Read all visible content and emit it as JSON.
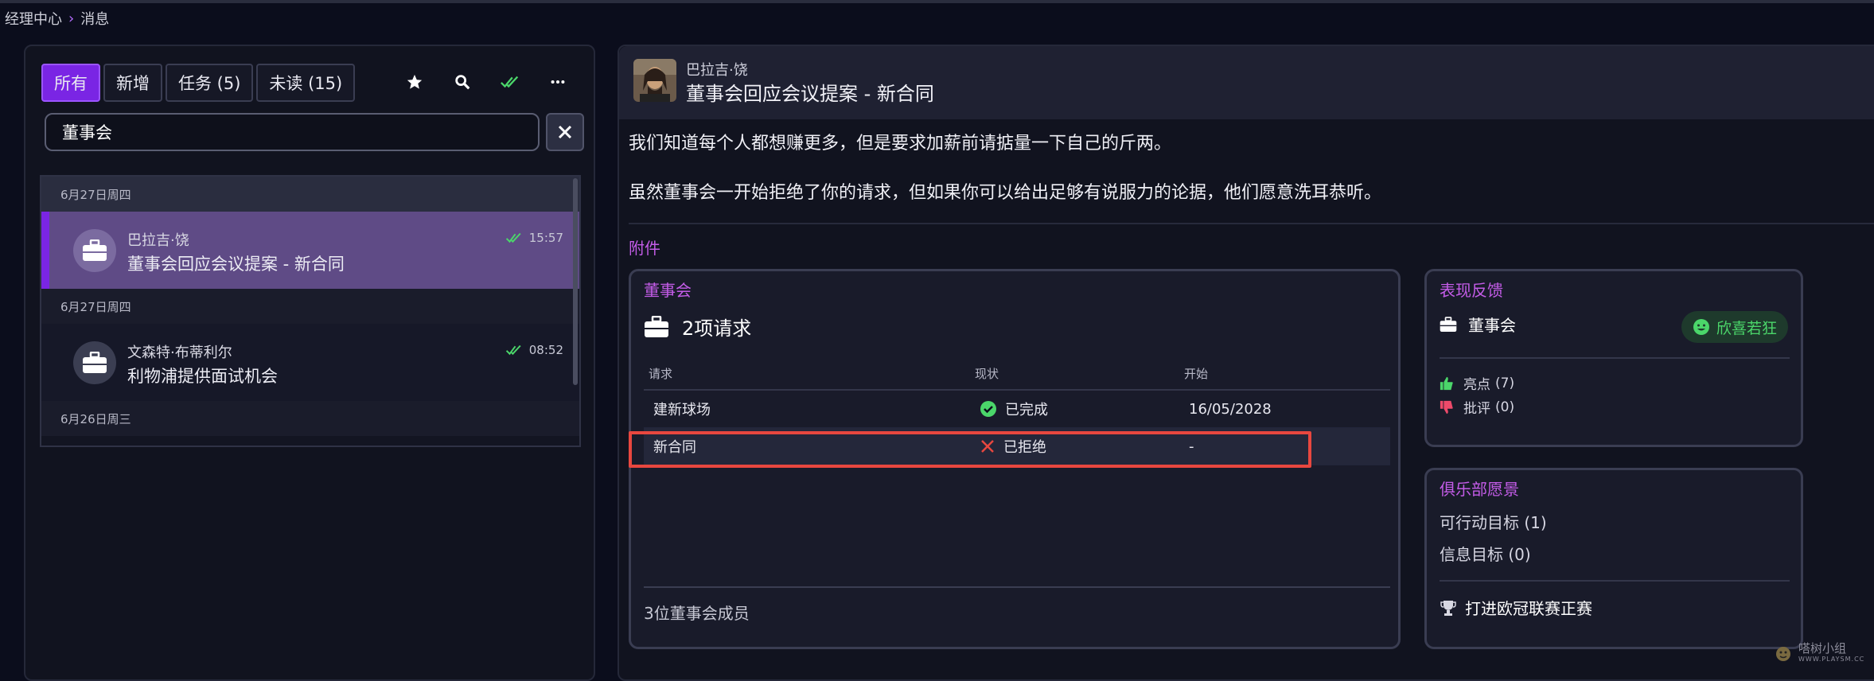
{
  "breadcrumb": {
    "root": "经理中心",
    "separator": "›",
    "current": "消息"
  },
  "tabs": [
    {
      "label": "所有",
      "active": true
    },
    {
      "label": "新增",
      "active": false
    },
    {
      "label": "任务 (5)",
      "active": false
    },
    {
      "label": "未读 (15)",
      "active": false
    }
  ],
  "toolbar_icons": [
    "star-icon",
    "search-icon",
    "double-check-icon",
    "more-icon"
  ],
  "search": {
    "value": "董事会"
  },
  "message_list": {
    "groups": [
      {
        "date": "6月27日周四",
        "sender": "巴拉吉·饶",
        "subject": "董事会回应会议提案 - 新合同",
        "time": "15:57",
        "selected": true
      },
      {
        "date": "6月27日周四",
        "sender": "文森特·布蒂利尔",
        "subject": "利物浦提供面试机会",
        "time": "08:52",
        "selected": false
      },
      {
        "date": "6月26日周三"
      }
    ]
  },
  "detail": {
    "sender": "巴拉吉·饶",
    "subject": "董事会回应会议提案 - 新合同",
    "body": [
      "我们知道每个人都想赚更多，但是要求加薪前请掂量一下自己的斤两。",
      "虽然董事会一开始拒绝了你的请求，但如果你可以给出足够有说服力的论据，他们愿意洗耳恭听。"
    ],
    "attachments_label": "附件"
  },
  "board_card": {
    "title": "董事会",
    "heading": "2项请求",
    "columns": [
      "请求",
      "现状",
      "开始"
    ],
    "rows": [
      {
        "request": "建新球场",
        "status": "已完成",
        "status_icon": "check-circle-icon",
        "start": "16/05/2028"
      },
      {
        "request": "新合同",
        "status": "已拒绝",
        "status_icon": "cross-icon",
        "start": "-"
      }
    ],
    "footer": "3位董事会成员"
  },
  "performance_card": {
    "title": "表现反馈",
    "entity": "董事会",
    "mood": "欣喜若狂",
    "highlights": "亮点",
    "highlights_count": "(7)",
    "criticisms": "批评",
    "criticisms_count": "(0)"
  },
  "vision_card": {
    "title": "俱乐部愿景",
    "actionable": "可行动目标",
    "actionable_count": "(1)",
    "info": "信息目标",
    "info_count": "(0)",
    "goal": "打进欧冠联赛正赛"
  },
  "watermark": {
    "text": "嗒树小组",
    "sub": "WWW.PLAYSM.CC"
  },
  "colors": {
    "accent": "#7a25e4",
    "pink": "#c45ce8",
    "success": "#4bd66a",
    "danger": "#e8473f"
  }
}
